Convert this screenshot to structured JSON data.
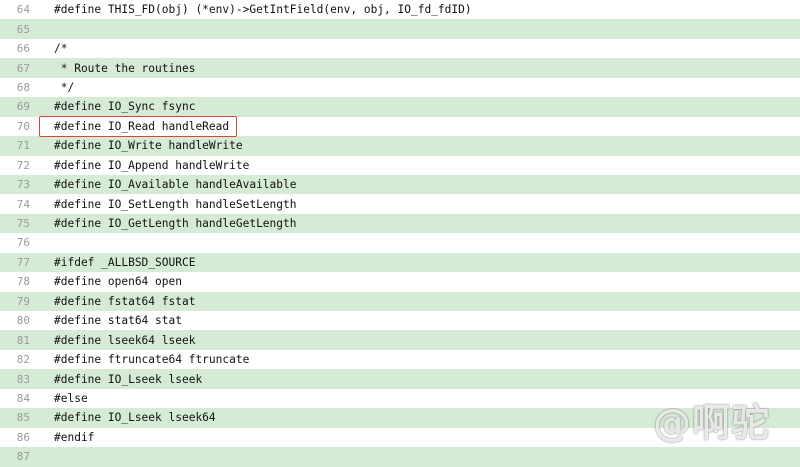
{
  "lines": [
    {
      "num": "64",
      "text": "#define THIS_FD(obj) (*env)->GetIntField(env, obj, IO_fd_fdID)"
    },
    {
      "num": "65",
      "text": ""
    },
    {
      "num": "66",
      "text": "/*"
    },
    {
      "num": "67",
      "text": " * Route the routines"
    },
    {
      "num": "68",
      "text": " */"
    },
    {
      "num": "69",
      "text": "#define IO_Sync fsync"
    },
    {
      "num": "70",
      "text": "#define IO_Read handleRead",
      "highlighted": true
    },
    {
      "num": "71",
      "text": "#define IO_Write handleWrite"
    },
    {
      "num": "72",
      "text": "#define IO_Append handleWrite"
    },
    {
      "num": "73",
      "text": "#define IO_Available handleAvailable"
    },
    {
      "num": "74",
      "text": "#define IO_SetLength handleSetLength"
    },
    {
      "num": "75",
      "text": "#define IO_GetLength handleGetLength"
    },
    {
      "num": "76",
      "text": ""
    },
    {
      "num": "77",
      "text": "#ifdef _ALLBSD_SOURCE"
    },
    {
      "num": "78",
      "text": "#define open64 open"
    },
    {
      "num": "79",
      "text": "#define fstat64 fstat"
    },
    {
      "num": "80",
      "text": "#define stat64 stat"
    },
    {
      "num": "81",
      "text": "#define lseek64 lseek"
    },
    {
      "num": "82",
      "text": "#define ftruncate64 ftruncate"
    },
    {
      "num": "83",
      "text": "#define IO_Lseek lseek"
    },
    {
      "num": "84",
      "text": "#else"
    },
    {
      "num": "85",
      "text": "#define IO_Lseek lseek64"
    },
    {
      "num": "86",
      "text": "#endif"
    },
    {
      "num": "87",
      "text": ""
    }
  ],
  "watermark": "@啊驼",
  "colors": {
    "row_odd": "#d6ebd6",
    "row_even": "#ffffff",
    "highlight_box": "#d9453a",
    "line_number": "#9a9a9a"
  }
}
